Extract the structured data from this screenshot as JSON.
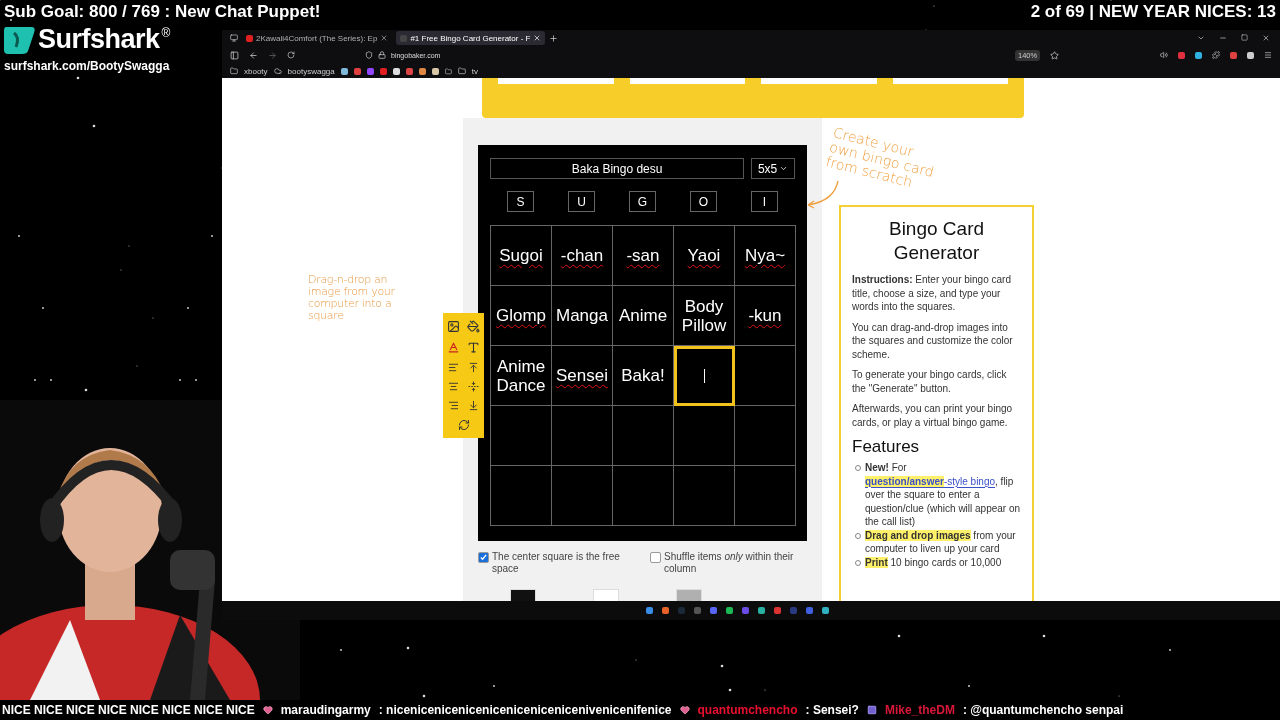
{
  "overlay": {
    "sub_goal": "Sub Goal: 800 / 769 : New Chat Puppet!",
    "counter": "2 of 69 | NEW YEAR NICES: 13",
    "sponsor": {
      "name": "Surfshark",
      "mark": "®",
      "url": "surfshark.com/BootySwagga"
    }
  },
  "browser": {
    "tabs": [
      {
        "label": "2Kawaii4Comfort (The Series): Ep",
        "selected": false
      },
      {
        "label": "#1 Free Bingo Card Generator - F",
        "selected": true
      }
    ],
    "address": "bingobaker.com",
    "zoom": "140%",
    "bookmarks": [
      "xbooty",
      "bootyswagga",
      "tv"
    ]
  },
  "page": {
    "hint_left": "Drag-n-drop an image from your computer into a square",
    "hint_right": "Create your own bingo card from scratch",
    "card": {
      "title": "Baka Bingo desu",
      "size": "5x5",
      "headers": [
        "S",
        "U",
        "G",
        "O",
        "I"
      ],
      "rows": [
        [
          {
            "text": "Sugoi",
            "misspelled": true,
            "selected": false
          },
          {
            "text": "-chan",
            "misspelled": true,
            "selected": false
          },
          {
            "text": "-san",
            "misspelled": true,
            "selected": false
          },
          {
            "text": "Yaoi",
            "misspelled": true,
            "selected": false
          },
          {
            "text": "Nya~",
            "misspelled": true,
            "selected": false
          }
        ],
        [
          {
            "text": "Glomp",
            "misspelled": true,
            "selected": false
          },
          {
            "text": "Manga",
            "misspelled": false,
            "selected": false
          },
          {
            "text": "Anime",
            "misspelled": false,
            "selected": false
          },
          {
            "text": "Body Pillow",
            "misspelled": false,
            "selected": false
          },
          {
            "text": "-kun",
            "misspelled": true,
            "selected": false
          }
        ],
        [
          {
            "text": "Anime Dance",
            "misspelled": false,
            "selected": false
          },
          {
            "text": "Sensei",
            "misspelled": true,
            "selected": false
          },
          {
            "text": "Baka!",
            "misspelled": false,
            "selected": false
          },
          {
            "selected": true
          },
          {
            "selected": false
          }
        ],
        [
          {
            "selected": false
          },
          {
            "selected": false
          },
          {
            "selected": false
          },
          {
            "selected": false
          },
          {
            "selected": false
          }
        ],
        [
          {
            "selected": false
          },
          {
            "selected": false
          },
          {
            "selected": false
          },
          {
            "selected": false
          },
          {
            "selected": false
          }
        ]
      ]
    },
    "options": [
      {
        "label": "The center square is the free space",
        "checked": true
      },
      {
        "label": "Shuffle items *only* within their column",
        "checked": false
      }
    ],
    "swatches": [
      {
        "color": "#111111"
      },
      {
        "color": "#ffffff"
      },
      {
        "color": "#b0b0b0"
      }
    ],
    "info": {
      "heading": "Bingo Card Generator",
      "paragraphs": [
        "**Instructions:** Enter your bingo card title, choose a size, and type your words into the squares.",
        "You can drag-and-drop images into the squares and customize the color scheme.",
        "To generate your bingo cards, click the \"Generate\" button.",
        "Afterwards, you can print your bingo cards, or play a virtual bingo game."
      ],
      "features_heading": "Features",
      "features": [
        [
          {
            "kind": "bold",
            "text": "New!"
          },
          {
            "kind": "plain",
            "text": " For "
          },
          {
            "kind": "marked-link",
            "text": "question/answer"
          },
          {
            "kind": "link",
            "text": "-style bingo"
          },
          {
            "kind": "plain",
            "text": ", flip over the square to enter a question/clue (which will appear on the call list)"
          }
        ],
        [
          {
            "kind": "marked",
            "text": "Drag and drop images"
          },
          {
            "kind": "plain",
            "text": " from your computer to liven up your card"
          }
        ],
        [
          {
            "kind": "marked",
            "text": "Print"
          },
          {
            "kind": "plain",
            "text": " 10 bingo cards or 10,000"
          }
        ]
      ]
    }
  },
  "chat": [
    {
      "kind": "text",
      "text": "NICE NICE NICE NICE NICE NICE NICE NICE"
    },
    {
      "kind": "heart",
      "user": "maraudingarmy",
      "color": "#ffffff",
      "message": ": nicenicenicenicenicenicenicenicenivenicenifenice"
    },
    {
      "kind": "heart",
      "user": "quantumchencho",
      "color": "#e8102e",
      "message": ": Sensei?"
    },
    {
      "kind": "badge",
      "user": "Mike_theDM",
      "color": "#d81838",
      "message": ": @quantumchencho senpai"
    }
  ]
}
